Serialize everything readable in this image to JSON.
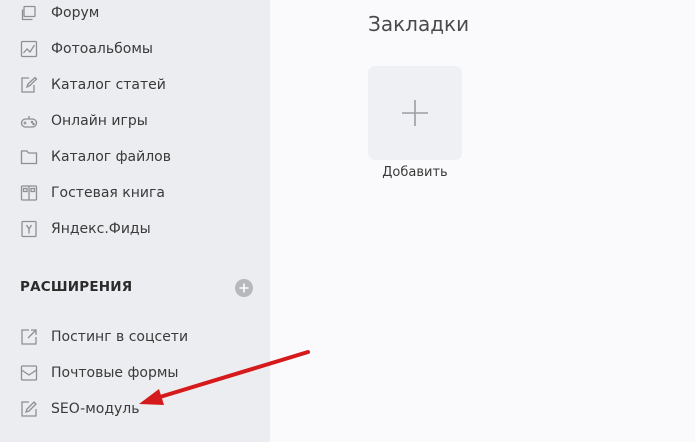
{
  "sidebar": {
    "items": [
      {
        "label": "Форум",
        "icon": "forum-icon"
      },
      {
        "label": "Фотоальбомы",
        "icon": "photo-album-icon"
      },
      {
        "label": "Каталог статей",
        "icon": "article-catalog-icon"
      },
      {
        "label": "Онлайн игры",
        "icon": "gamepad-icon"
      },
      {
        "label": "Каталог файлов",
        "icon": "folder-icon"
      },
      {
        "label": "Гостевая книга",
        "icon": "guestbook-icon"
      },
      {
        "label": "Яндекс.Фиды",
        "icon": "yandex-feeds-icon"
      }
    ],
    "extensions": {
      "title": "РАСШИРЕНИЯ",
      "add_icon": "plus-circle-icon",
      "items": [
        {
          "label": "Постинг в соцсети",
          "icon": "share-out-icon"
        },
        {
          "label": "Почтовые формы",
          "icon": "mail-icon"
        },
        {
          "label": "SEO-модуль",
          "icon": "seo-pen-icon"
        }
      ]
    }
  },
  "main": {
    "title": "Закладки",
    "add_tile": {
      "label": "Добавить",
      "icon": "plus-icon"
    }
  },
  "colors": {
    "sidebar_bg": "#ecedf0",
    "main_bg": "#fafafc",
    "arrow": "#d6191a"
  }
}
